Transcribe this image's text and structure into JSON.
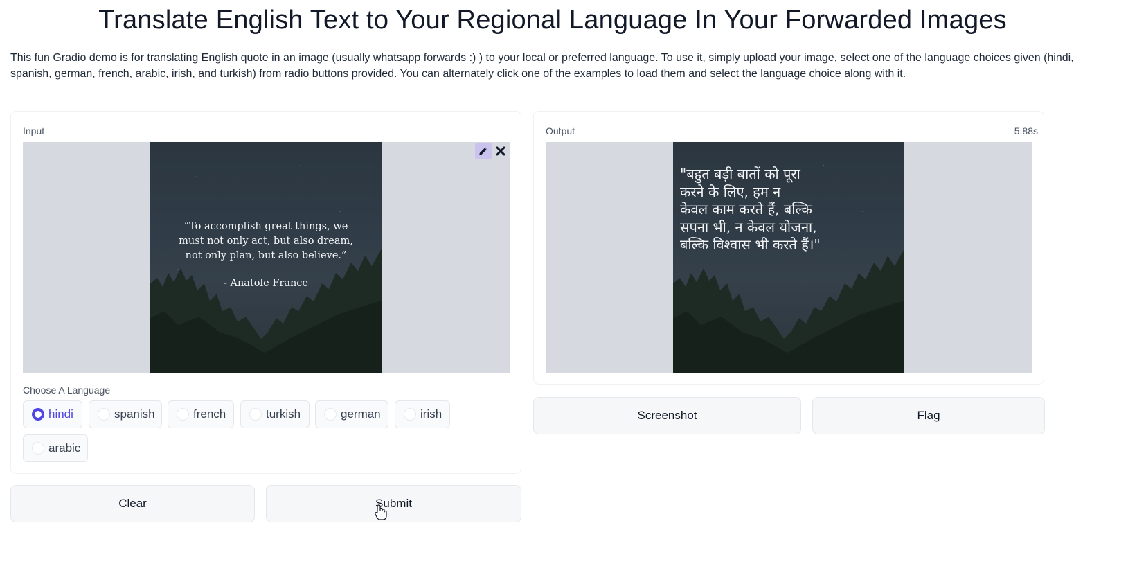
{
  "page": {
    "title": "Translate English Text to Your Regional Language In Your Forwarded Images",
    "description": "This fun Gradio demo is for translating English quote in an image (usually whatsapp forwards :) ) to your local or preferred language. To use it, simply upload your image, select one of the language choices given (hindi, spanish, german, french, arabic, irish, and turkish) from radio buttons provided. You can alternately click one of the examples to load them and select the language choice along with it."
  },
  "input": {
    "label": "Input",
    "image": {
      "quote_lines": [
        "“To accomplish great things, we",
        "must not only act, but also dream,",
        "not only plan, but also believe.”"
      ],
      "author": "- Anatole France"
    },
    "tools": {
      "edit_icon": "pencil-icon",
      "close_icon": "close-icon"
    },
    "language_label": "Choose A Language",
    "languages": [
      {
        "label": "hindi",
        "selected": true
      },
      {
        "label": "spanish",
        "selected": false
      },
      {
        "label": "french",
        "selected": false
      },
      {
        "label": "turkish",
        "selected": false
      },
      {
        "label": "german",
        "selected": false
      },
      {
        "label": "irish",
        "selected": false
      },
      {
        "label": "arabic",
        "selected": false
      }
    ],
    "clear_label": "Clear",
    "submit_label": "Submit"
  },
  "output": {
    "label": "Output",
    "time": "5.88s",
    "image": {
      "translated_lines": [
        "\"बहुत बड़ी बातों को पूरा",
        "करने के लिए, हम न",
        "केवल काम करते हैं, बल्कि",
        "सपना भी, न केवल योजना,",
        "बल्कि विश्वास भी करते हैं।\""
      ]
    },
    "screenshot_label": "Screenshot",
    "flag_label": "Flag"
  },
  "colors": {
    "accent": "#4f46e5",
    "image_bg": "#d6dae0",
    "button_bg": "#f6f7f9"
  }
}
